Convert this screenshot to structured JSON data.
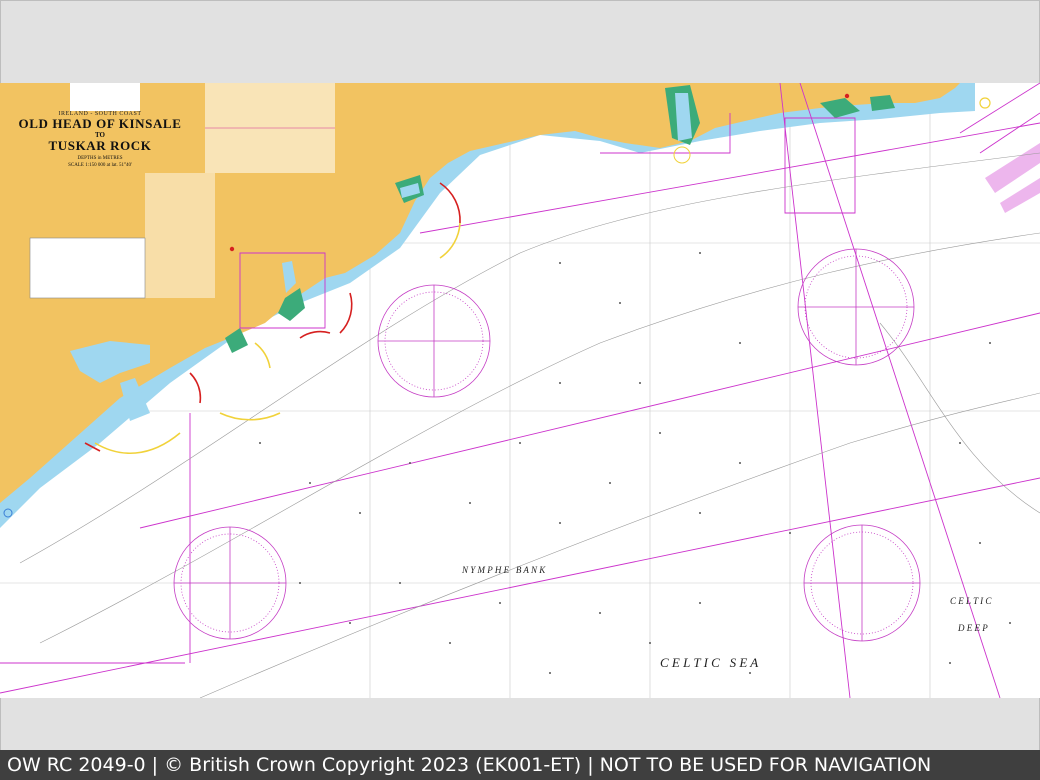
{
  "viewer": {
    "background": "#e1e1e1",
    "caption": "OW RC 2049-0 | © British Crown Copyright 2023 (EK001-ET) | NOT TO BE USED FOR NAVIGATION"
  },
  "chart": {
    "region": "IRELAND - SOUTH COAST",
    "title_line1": "OLD HEAD OF KINSALE",
    "title_to": "TO",
    "title_line2": "TUSKAR ROCK",
    "depths_label": "DEPTHS in METRES",
    "scale_label": "SCALE 1:150 000 at lat. 51°40'",
    "sea_labels": {
      "nymphe_bank": "N Y M P H E   B A N K",
      "celtic_sea": "C E L T I C   S E A",
      "celtic": "C E L T I C",
      "deep": "D E E P"
    },
    "colors": {
      "land": "#f2c361",
      "shallow": "#9fd7f0",
      "intertidal": "#3cab7a",
      "sea": "#ffffff",
      "magenta": "#cc33cc",
      "danger_red": "#d62020",
      "light_yellow": "#f1d23a"
    },
    "compass_roses": 4
  }
}
